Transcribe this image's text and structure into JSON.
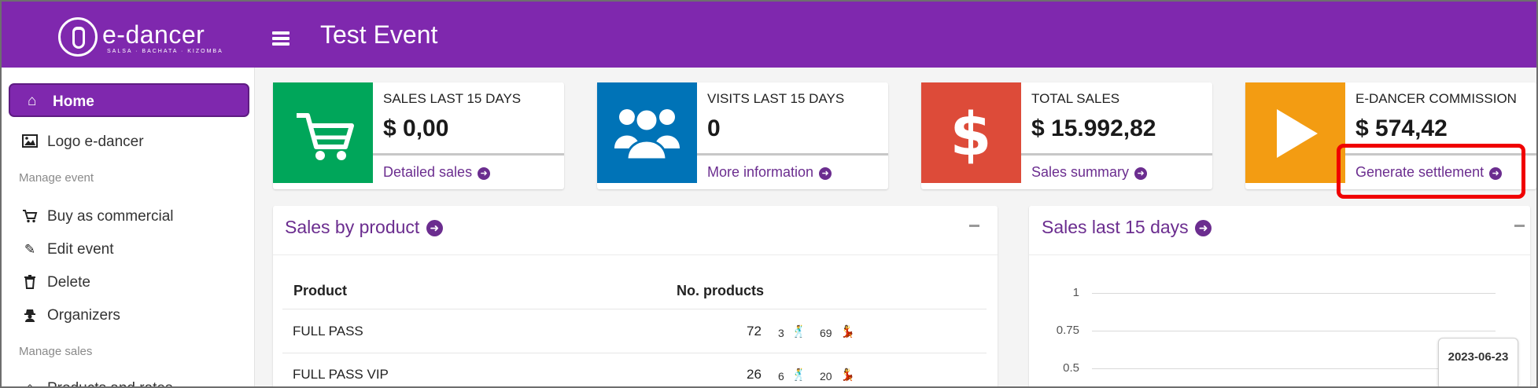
{
  "app": {
    "logo_name": "e-dancer",
    "logo_tagline": "SALSA · BACHATA · KIZOMBA",
    "event_title": "Test Event"
  },
  "sidebar": {
    "home_label": "Home",
    "logo_item_label": "Logo e-dancer",
    "manage_event_header": "Manage event",
    "manage_event_items": [
      "Buy as commercial",
      "Edit event",
      "Delete",
      "Organizers"
    ],
    "manage_sales_header": "Manage sales",
    "products_rates_label": "Products and rates"
  },
  "info_boxes": [
    {
      "label": "SALES LAST 15 DAYS",
      "value": "$ 0,00",
      "link": "Detailed sales",
      "color": "#00a65a",
      "icon": "shopping-cart-icon"
    },
    {
      "label": "VISITS LAST 15 DAYS",
      "value": "0",
      "link": "More information",
      "color": "#0073b7",
      "icon": "users-icon"
    },
    {
      "label": "TOTAL SALES",
      "value": "$ 15.992,82",
      "link": "Sales summary",
      "color": "#dd4b39",
      "icon": "dollar-icon"
    },
    {
      "label": "E-DANCER COMMISSION",
      "value": "$ 574,42",
      "link": "Generate settlement",
      "color": "#f39c12",
      "icon": "play-icon"
    }
  ],
  "sales_by_product": {
    "title": "Sales by product",
    "columns": [
      "Product",
      "No. products"
    ],
    "rows": [
      {
        "product": "FULL PASS",
        "total": "72",
        "leaders": "3",
        "followers": "69"
      },
      {
        "product": "FULL PASS VIP",
        "total": "26",
        "leaders": "6",
        "followers": "20"
      }
    ]
  },
  "sales_last_15_days": {
    "title": "Sales last 15 days",
    "tooltip_date": "2023-06-23"
  },
  "chart_data": {
    "type": "line",
    "title": "Sales last 15 days",
    "y_ticks": [
      "1",
      "0.75",
      "0.5"
    ],
    "x": [
      "2023-06-23"
    ],
    "series": []
  },
  "colors": {
    "brand": "#7f28ae",
    "link": "#6b2d8f",
    "highlight": "#f00000"
  }
}
